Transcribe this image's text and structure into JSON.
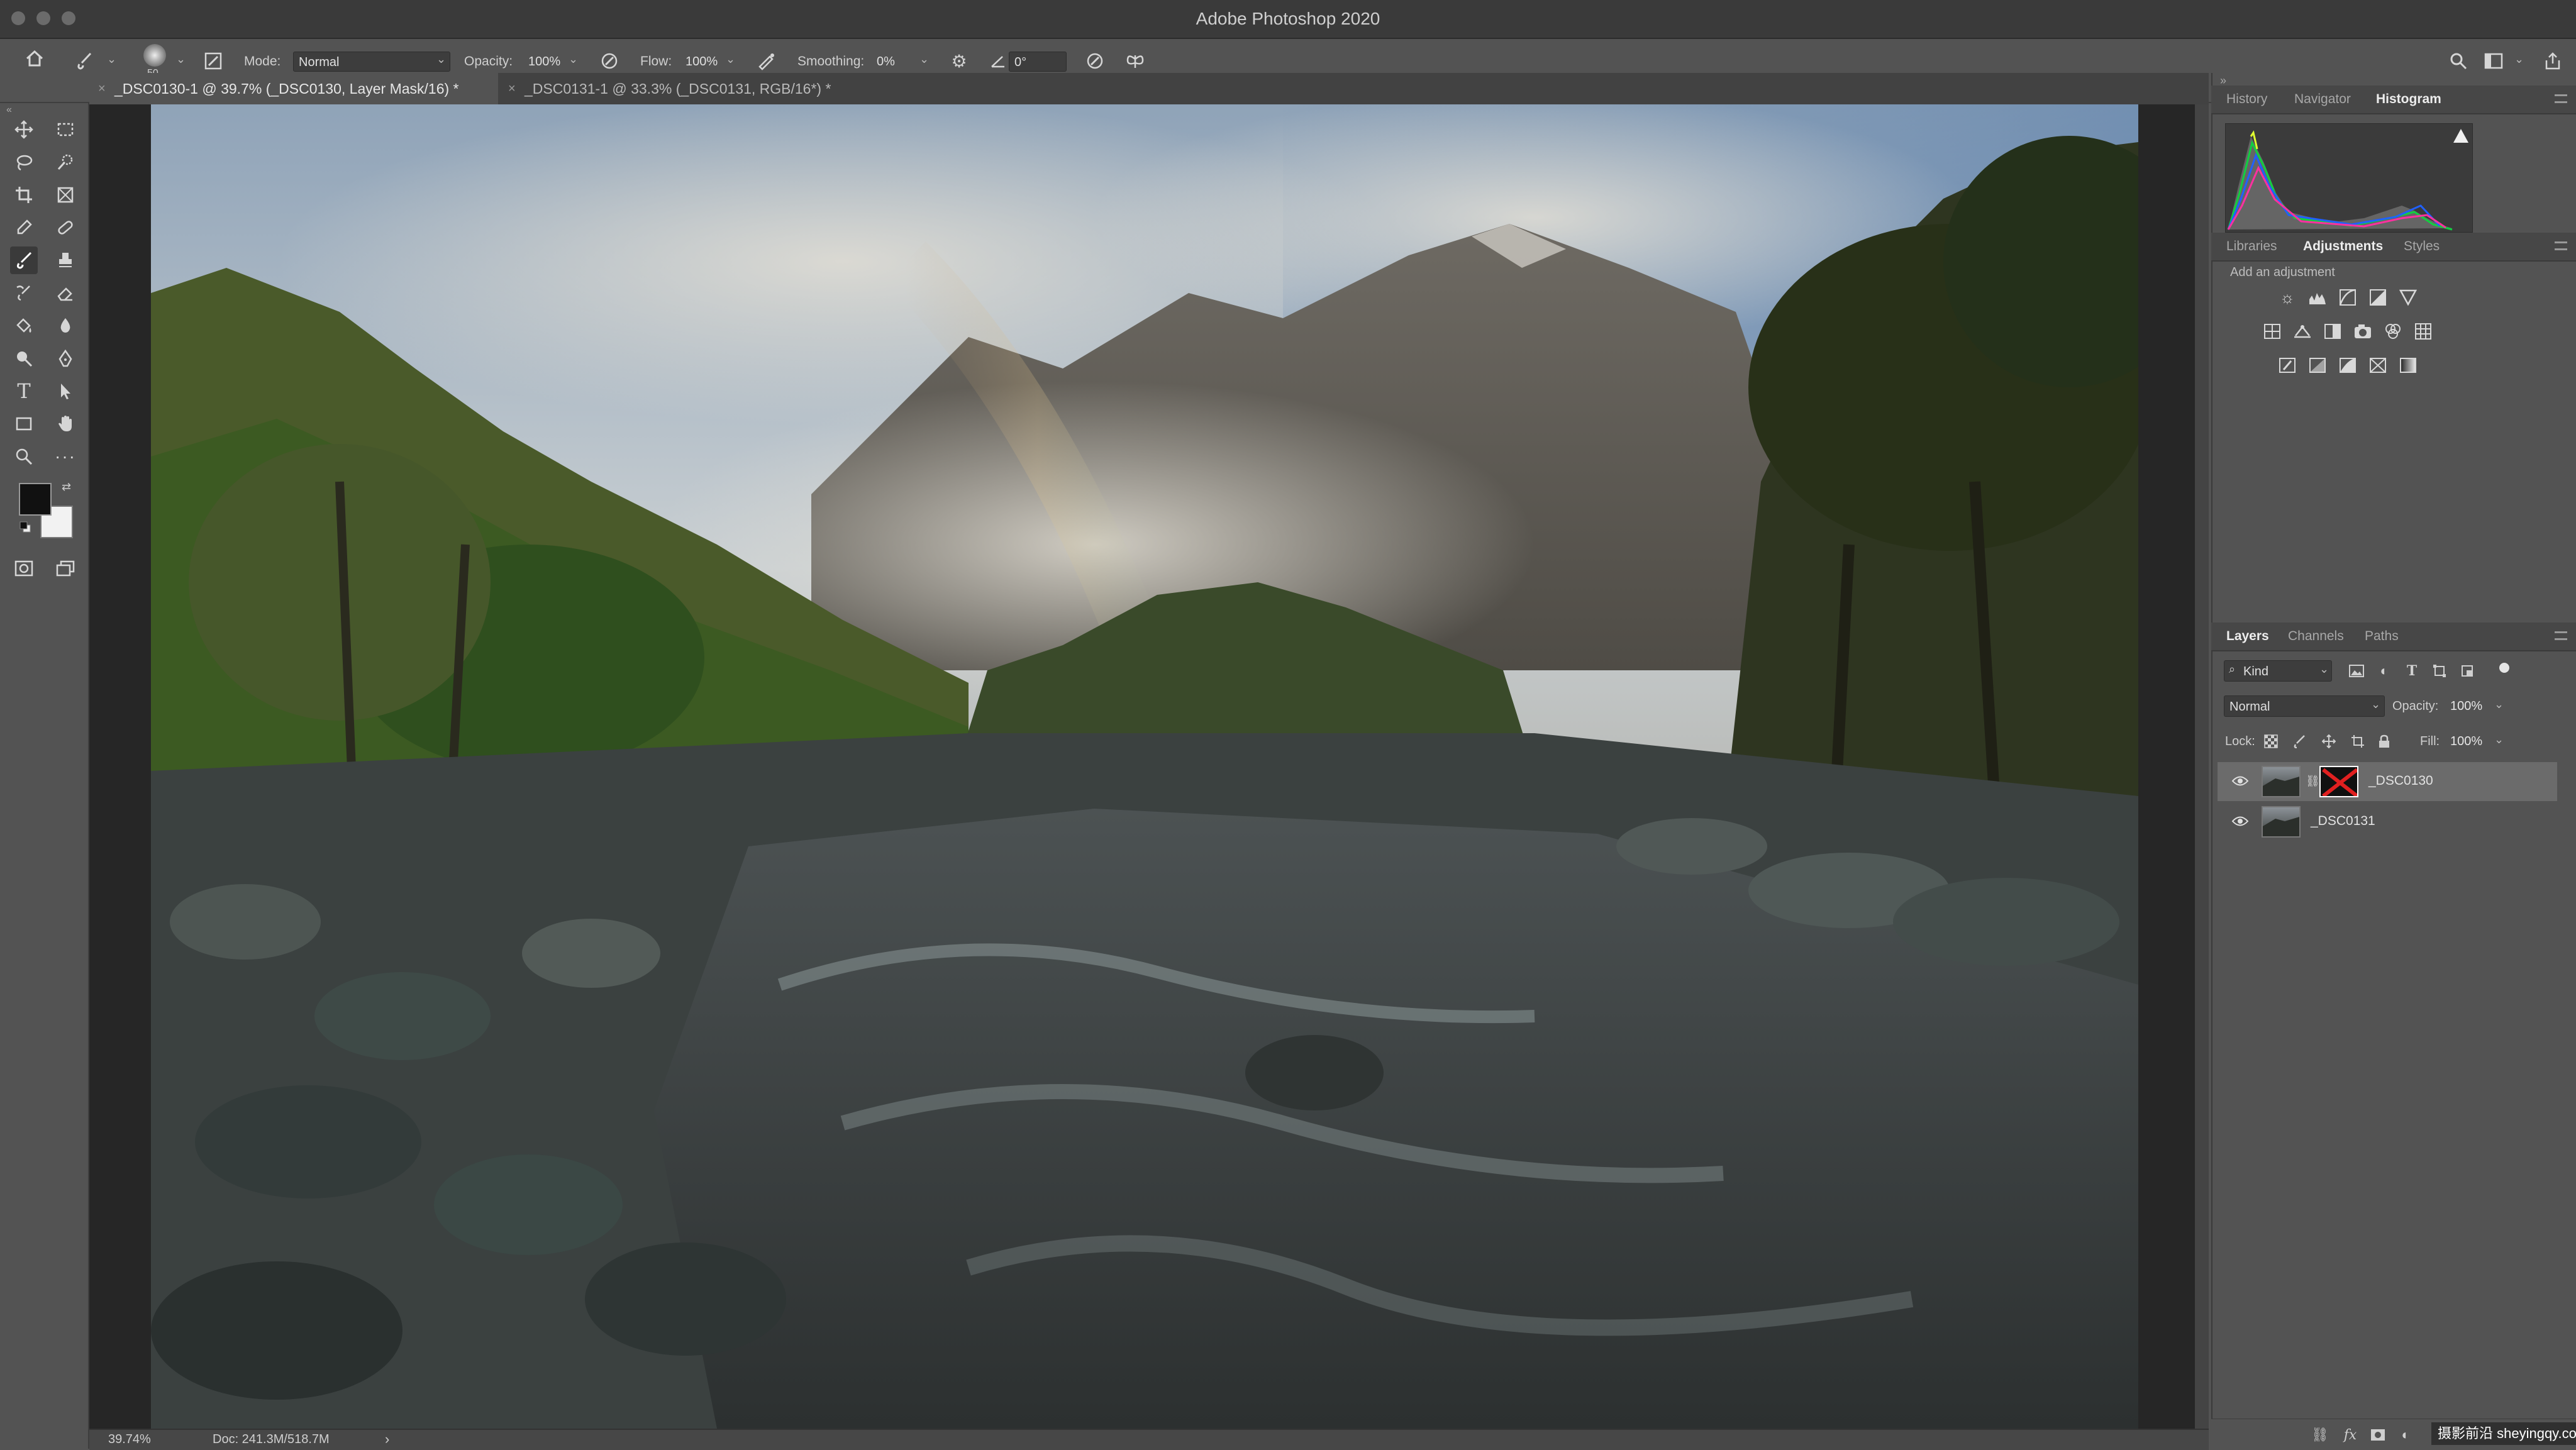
{
  "app": {
    "title": "Adobe Photoshop 2020"
  },
  "options": {
    "brush_size": "50",
    "mode_label": "Mode:",
    "mode_value": "Normal",
    "opacity_label": "Opacity:",
    "opacity_value": "100%",
    "flow_label": "Flow:",
    "flow_value": "100%",
    "smoothing_label": "Smoothing:",
    "smoothing_value": "0%",
    "angle_value": "0°"
  },
  "documents": {
    "tabs": [
      {
        "label": "_DSC0130-1 @ 39.7% (_DSC0130, Layer Mask/16) *",
        "close": "×"
      },
      {
        "label": "_DSC0131-1 @ 33.3% (_DSC0131, RGB/16*) *",
        "close": "×"
      }
    ]
  },
  "status": {
    "zoom": "39.74%",
    "doc": "Doc: 241.3M/518.7M",
    "arrow": "›"
  },
  "panels": {
    "top_tabs": [
      "History",
      "Navigator",
      "Histogram"
    ],
    "mid_tabs": [
      "Libraries",
      "Adjustments",
      "Styles"
    ],
    "adjustments_hint": "Add an adjustment",
    "layers_tabs": [
      "Layers",
      "Channels",
      "Paths"
    ],
    "filter_kind": "Kind",
    "blend_mode": "Normal",
    "opacity_label": "Opacity:",
    "opacity_value": "100%",
    "lock_label": "Lock:",
    "fill_label": "Fill:",
    "fill_value": "100%",
    "layers": [
      {
        "name": "_DSC0130"
      },
      {
        "name": "_DSC0131"
      }
    ]
  },
  "watermark": "摄影前沿 sheyingqy.com",
  "colors": {
    "foreground": "#111111",
    "background": "#f2f2f2",
    "ui_dark": "#535353"
  }
}
